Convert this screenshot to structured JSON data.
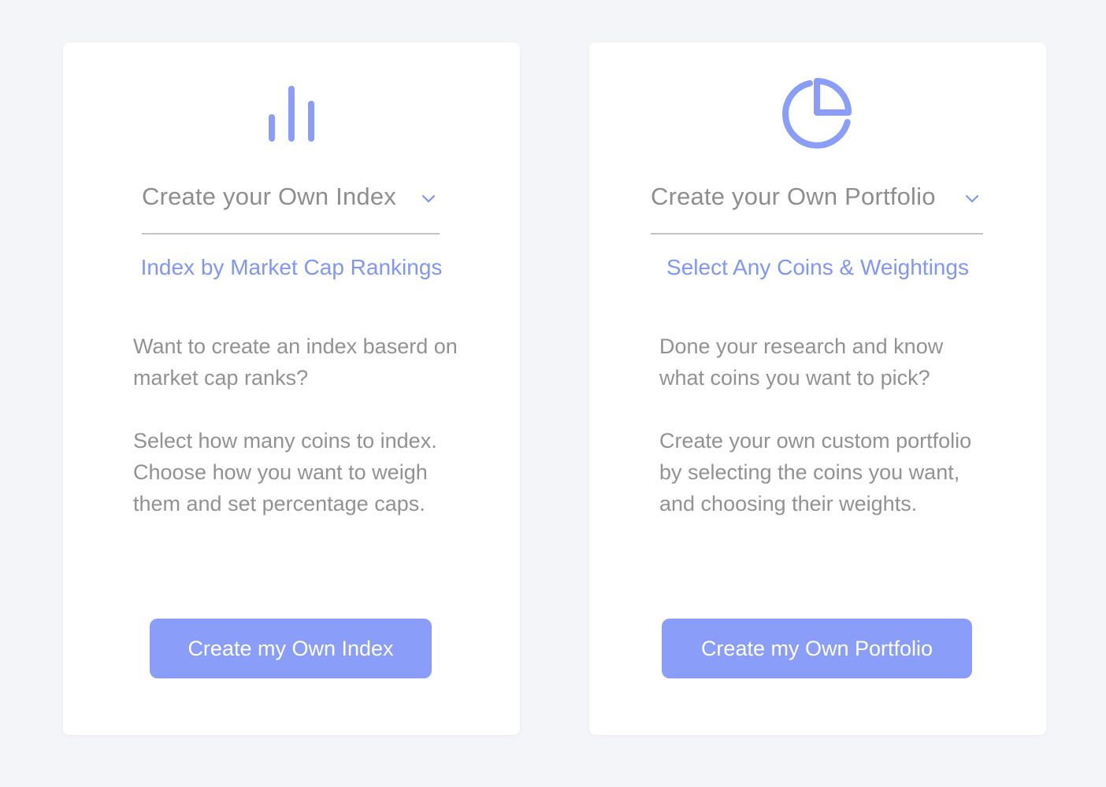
{
  "colors": {
    "background": "#f4f5f9",
    "card": "#ffffff",
    "accent": "#8196f7",
    "button": "#8a9ef9",
    "text_muted": "#929292",
    "divider": "#c4c4c4"
  },
  "cards": [
    {
      "icon": "bar-chart-icon",
      "selector_label": "Create your Own Index",
      "subtitle": "Index by Market Cap Rankings",
      "paragraphs": [
        "Want to create an index baserd on market cap ranks?",
        "Select how many coins to index. Choose how you want to weigh them and set percentage caps."
      ],
      "button_label": "Create my Own Index"
    },
    {
      "icon": "pie-chart-icon",
      "selector_label": "Create your Own Portfolio",
      "subtitle": "Select Any Coins & Weightings",
      "paragraphs": [
        "Done your research and know what coins you want to pick?",
        "Create your own custom portfolio by selecting the coins you want, and choosing their weights."
      ],
      "button_label": "Create my Own Portfolio"
    }
  ]
}
